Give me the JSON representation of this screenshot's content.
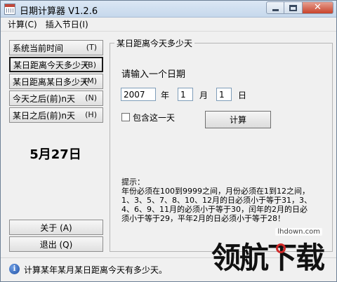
{
  "window": {
    "title": "日期计算器  V1.2.6"
  },
  "menu": {
    "items": [
      "计算(C)",
      "插入节日(I)"
    ]
  },
  "left_buttons": [
    {
      "label": "系统当前时间",
      "hotkey": "(T)"
    },
    {
      "label": "某日距离今天多少天",
      "hotkey": "(B)"
    },
    {
      "label": "某日距离某日多少天",
      "hotkey": "(M)"
    },
    {
      "label": "今天之后(前)n天",
      "hotkey": "(N)"
    },
    {
      "label": "某日之后(前)n天",
      "hotkey": "(H)"
    }
  ],
  "current_date": "5月27日",
  "bottom_buttons": {
    "about": "关于 (A)",
    "exit": "退出 (Q)"
  },
  "group": {
    "title": "某日距离今天多少天",
    "prompt": "请输入一个日期",
    "year_value": "2007",
    "year_unit": "年",
    "month_value": "1",
    "month_unit": "月",
    "day_value": "1",
    "day_unit": "日",
    "checkbox_label": "包含这一天",
    "calc_label": "计算",
    "hint": "提示：\n年份必须在100到9999之间，月份必须在1到12之间，\n1、3、5、7、8、10、12月的日必须小于等于31，3、\n4、6、9、11月的必须小于等于30，闰年的2月的日必\n须小于等于29，平年2月的日必须小于等于28！"
  },
  "status": {
    "text": "计算某年某月某日距离今天有多少天。"
  },
  "watermark": {
    "site": "lhdown.com",
    "logo": "领航下载"
  }
}
